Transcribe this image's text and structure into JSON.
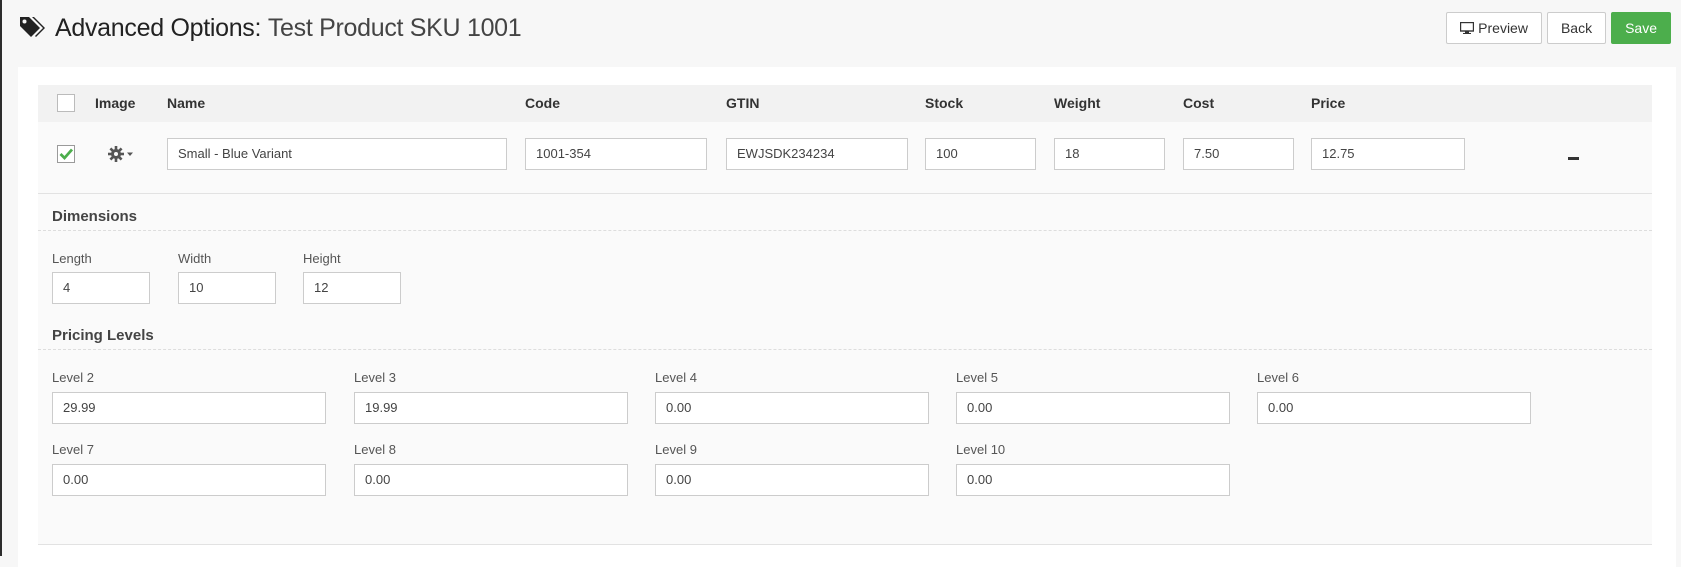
{
  "header": {
    "title_prefix": "Advanced Options:",
    "title_name": "Test Product SKU 1001",
    "buttons": {
      "preview": "Preview",
      "back": "Back",
      "save": "Save"
    }
  },
  "table": {
    "columns": {
      "image": "Image",
      "name": "Name",
      "code": "Code",
      "gtin": "GTIN",
      "stock": "Stock",
      "weight": "Weight",
      "cost": "Cost",
      "price": "Price"
    },
    "row": {
      "name": "Small - Blue Variant",
      "code": "1001-354",
      "gtin": "EWJSDK234234",
      "stock": "100",
      "weight": "18",
      "cost": "7.50",
      "price": "12.75"
    }
  },
  "dimensions": {
    "title": "Dimensions",
    "length_label": "Length",
    "length": "4",
    "width_label": "Width",
    "width": "10",
    "height_label": "Height",
    "height": "12"
  },
  "pricing": {
    "title": "Pricing Levels",
    "levels": [
      {
        "label": "Level 2",
        "value": "29.99"
      },
      {
        "label": "Level 3",
        "value": "19.99"
      },
      {
        "label": "Level 4",
        "value": "0.00"
      },
      {
        "label": "Level 5",
        "value": "0.00"
      },
      {
        "label": "Level 6",
        "value": "0.00"
      },
      {
        "label": "Level 7",
        "value": "0.00"
      },
      {
        "label": "Level 8",
        "value": "0.00"
      },
      {
        "label": "Level 9",
        "value": "0.00"
      },
      {
        "label": "Level 10",
        "value": "0.00"
      }
    ]
  },
  "colors": {
    "accent": "#4cae4c",
    "text": "#333333"
  },
  "icons": {
    "title": "tags-icon",
    "preview": "monitor-icon",
    "image": "gear-icon",
    "remove": "minus-icon",
    "select": "checkbox-icon"
  }
}
